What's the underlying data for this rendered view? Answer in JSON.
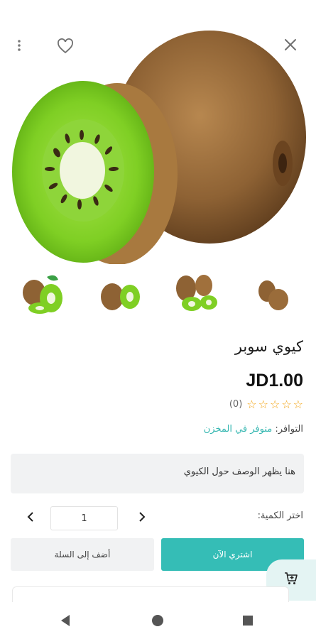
{
  "header": {
    "more_icon": "more-vertical-icon",
    "favorite_icon": "heart-icon",
    "close_icon": "close-icon"
  },
  "gallery": {
    "main_image": "kiwi-main-image",
    "thumbnails": [
      {
        "name": "kiwi-thumbnail-1"
      },
      {
        "name": "kiwi-thumbnail-2"
      },
      {
        "name": "kiwi-thumbnail-3"
      },
      {
        "name": "kiwi-thumbnail-4"
      }
    ]
  },
  "product": {
    "title": "كيوي سوبر",
    "price": "JD1.00",
    "rating": 0,
    "stars": [
      "☆",
      "☆",
      "☆",
      "☆",
      "☆"
    ],
    "review_count": "(0)",
    "availability_label": "التوافر:",
    "availability_value": "متوفر في المخزن",
    "description": "هنا يظهر الوصف حول الكيوي"
  },
  "quantity": {
    "label": "اختر الكمية:",
    "value": "1",
    "prev_icon": "chevron-left-icon",
    "next_icon": "chevron-right-icon"
  },
  "actions": {
    "add_to_cart": "أضف إلى السلة",
    "buy_now": "اشتري الآن",
    "cart_fab_icon": "cart-icon"
  },
  "nav": {
    "back_icon": "back-triangle-icon",
    "home_icon": "home-circle-icon",
    "recent_icon": "recent-square-icon"
  },
  "colors": {
    "accent": "#35bdb6",
    "star": "#f3a516",
    "availability": "#33b6b0"
  }
}
